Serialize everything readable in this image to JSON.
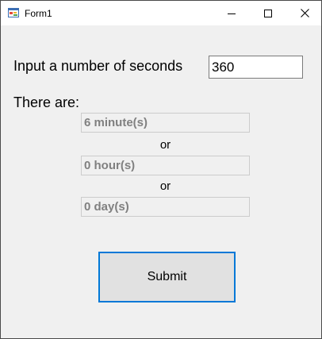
{
  "window": {
    "title": "Form1",
    "icon": "winforms-app-icon",
    "controls": {
      "minimize_icon": "minimize-icon",
      "maximize_icon": "maximize-icon",
      "close_icon": "close-icon"
    }
  },
  "form": {
    "prompt_label": "Input a number of seconds",
    "seconds_value": "360",
    "result_label": "There are:",
    "minutes_text": "6 minute(s)",
    "or_1": "or",
    "hours_text": "0 hour(s)",
    "or_2": "or",
    "days_text": "0 day(s)",
    "submit_label": "Submit"
  },
  "colors": {
    "accent_focus": "#0078d7",
    "form_background": "#f0f0f0",
    "disabled_text": "#808080"
  }
}
